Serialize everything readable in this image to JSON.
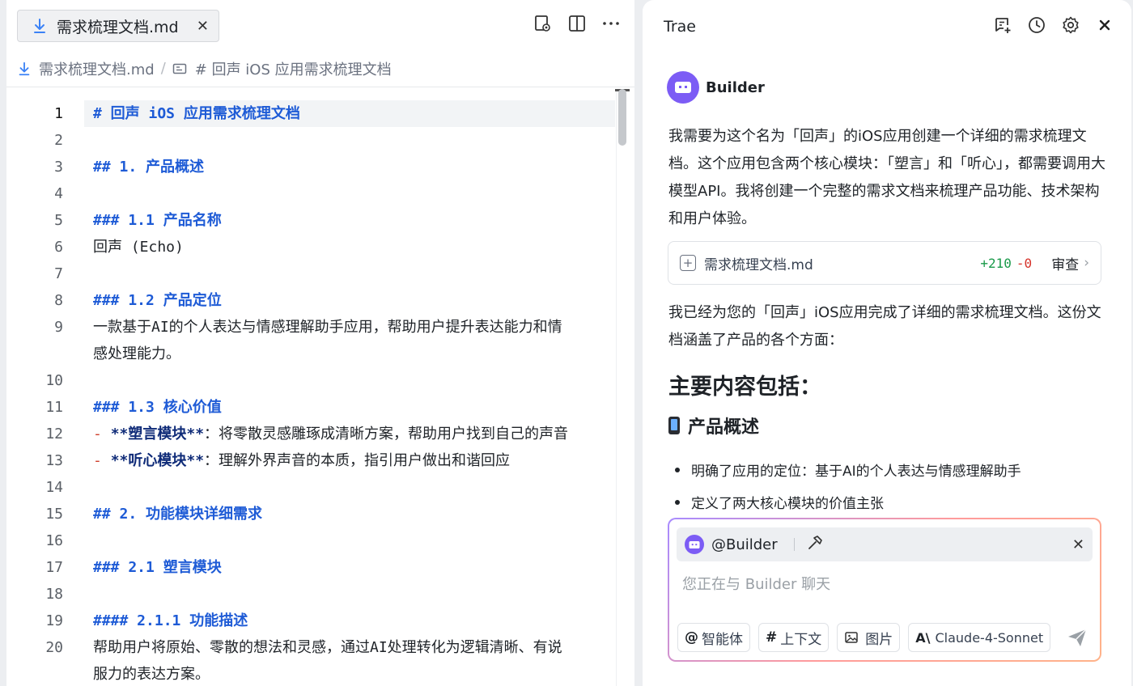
{
  "editor": {
    "tab_label": "需求梳理文档.md",
    "breadcrumb": {
      "file": "需求梳理文档.md",
      "section": "# 回声 iOS 应用需求梳理文档"
    },
    "lines": [
      {
        "n": "1",
        "parts": [
          {
            "cls": "hd",
            "text": "# 回声 iOS 应用需求梳理文档"
          }
        ]
      },
      {
        "n": "2",
        "parts": []
      },
      {
        "n": "3",
        "parts": [
          {
            "cls": "hd",
            "text": "## 1. 产品概述"
          }
        ]
      },
      {
        "n": "4",
        "parts": []
      },
      {
        "n": "5",
        "parts": [
          {
            "cls": "hd",
            "text": "### 1.1 产品名称"
          }
        ]
      },
      {
        "n": "6",
        "parts": [
          {
            "cls": "",
            "text": "回声 (Echo)"
          }
        ]
      },
      {
        "n": "7",
        "parts": []
      },
      {
        "n": "8",
        "parts": [
          {
            "cls": "hd",
            "text": "### 1.2 产品定位"
          }
        ]
      },
      {
        "n": "9",
        "parts": [
          {
            "cls": "",
            "text": "一款基于AI的个人表达与情感理解助手应用，帮助用户提升表达能力和情"
          }
        ],
        "cont": "感处理能力。"
      },
      {
        "n": "10",
        "parts": []
      },
      {
        "n": "11",
        "parts": [
          {
            "cls": "hd",
            "text": "### 1.3 核心价值"
          }
        ]
      },
      {
        "n": "12",
        "parts": [
          {
            "cls": "bullet",
            "text": "- "
          },
          {
            "cls": "bold",
            "text": "**塑言模块**"
          },
          {
            "cls": "",
            "text": "：将零散灵感雕琢成清晰方案，帮助用户找到自己的声音"
          }
        ]
      },
      {
        "n": "13",
        "parts": [
          {
            "cls": "bullet",
            "text": "- "
          },
          {
            "cls": "bold",
            "text": "**听心模块**"
          },
          {
            "cls": "",
            "text": "：理解外界声音的本质，指引用户做出和谐回应"
          }
        ]
      },
      {
        "n": "14",
        "parts": []
      },
      {
        "n": "15",
        "parts": [
          {
            "cls": "hd",
            "text": "## 2. 功能模块详细需求"
          }
        ]
      },
      {
        "n": "16",
        "parts": []
      },
      {
        "n": "17",
        "parts": [
          {
            "cls": "hd",
            "text": "### 2.1 塑言模块"
          }
        ]
      },
      {
        "n": "18",
        "parts": []
      },
      {
        "n": "19",
        "parts": [
          {
            "cls": "hd",
            "text": "#### 2.1.1 功能描述"
          }
        ]
      },
      {
        "n": "20",
        "parts": [
          {
            "cls": "",
            "text": "帮助用户将原始、零散的想法和灵感，通过AI处理转化为逻辑清晰、有说"
          }
        ],
        "cont": "服力的表达方案。"
      }
    ]
  },
  "chat": {
    "title": "Trae",
    "agent_name": "Builder",
    "intro_message": "我需要为这个名为「回声」的iOS应用创建一个详细的需求梳理文档。这个应用包含两个核心模块：「塑言」和「听心」，都需要调用大模型API。我将创建一个完整的需求文档来梳理产品功能、技术架构和用户体验。",
    "file_card": {
      "name": "需求梳理文档.md",
      "added": "+210",
      "removed": "-0",
      "review_label": "审查"
    },
    "done_message": "我已经为您的「回声」iOS应用完成了详细的需求梳理文档。这份文档涵盖了产品的各个方面：",
    "heading": "主要内容包括：",
    "subheading": "产品概述",
    "bullets": [
      "明确了应用的定位：基于AI的个人表达与情感理解助手",
      "定义了两大核心模块的价值主张"
    ],
    "composer": {
      "agent_tag": "@Builder",
      "placeholder": "您正在与 Builder 聊天",
      "chip_agent": "智能体",
      "chip_context": "上下文",
      "chip_image": "图片",
      "model": "Claude-4-Sonnet"
    }
  },
  "colors": {
    "accent_purple": "#7c5cf5",
    "heading_blue": "#1e5bd6",
    "bullet_red": "#d0402e",
    "added_green": "#1a9a4a",
    "removed_red": "#d6332a"
  }
}
